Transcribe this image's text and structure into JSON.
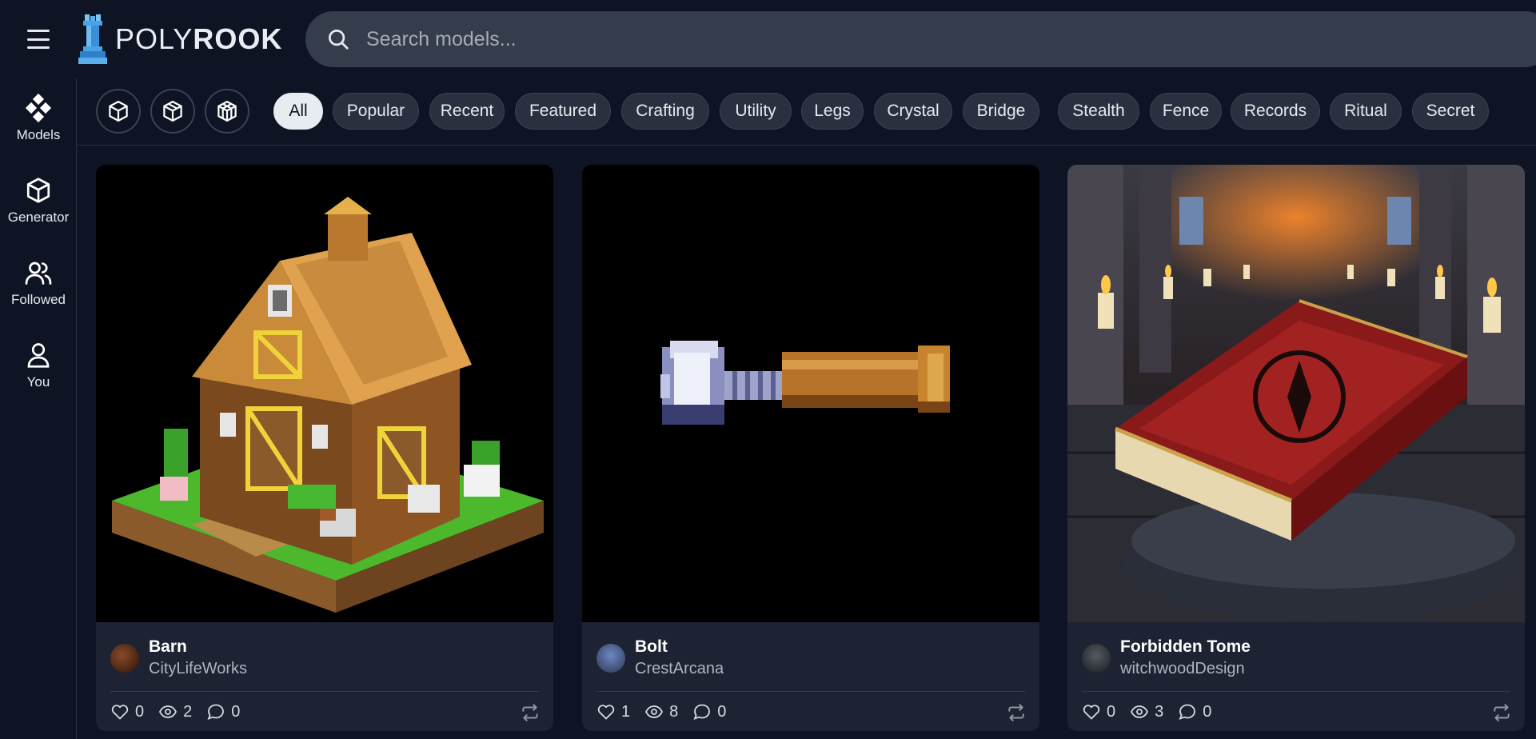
{
  "header": {
    "logo_part1": "POLY",
    "logo_part2": "ROOK",
    "search_placeholder": "Search models..."
  },
  "sidebar": {
    "items": [
      {
        "label": "Models",
        "icon": "models-icon"
      },
      {
        "label": "Generator",
        "icon": "cube-icon"
      },
      {
        "label": "Followed",
        "icon": "users-icon"
      },
      {
        "label": "You",
        "icon": "user-icon"
      }
    ]
  },
  "filters": {
    "view_buttons": [
      "cube-outline-icon",
      "cube-split-icon",
      "cube-grid-icon"
    ],
    "chips": [
      "All",
      "Popular",
      "Recent",
      "Featured",
      "Crafting",
      "Utility",
      "Legs",
      "Crystal",
      "Bridge",
      "Stealth",
      "Fence",
      "Records",
      "Ritual",
      "Secret"
    ],
    "active": "All"
  },
  "cards": [
    {
      "title": "Barn",
      "author": "CityLifeWorks",
      "likes": "0",
      "views": "2",
      "comments": "0"
    },
    {
      "title": "Bolt",
      "author": "CrestArcana",
      "likes": "1",
      "views": "8",
      "comments": "0"
    },
    {
      "title": "Forbidden Tome",
      "author": "witchwoodDesign",
      "likes": "0",
      "views": "3",
      "comments": "0"
    }
  ],
  "colors": {
    "background": "#0f1424",
    "card": "#1d2333",
    "chip": "#2a3040",
    "chip_active": "#e8ebf0",
    "search": "#353c4c",
    "logo_accent": "#4aa3e8"
  }
}
